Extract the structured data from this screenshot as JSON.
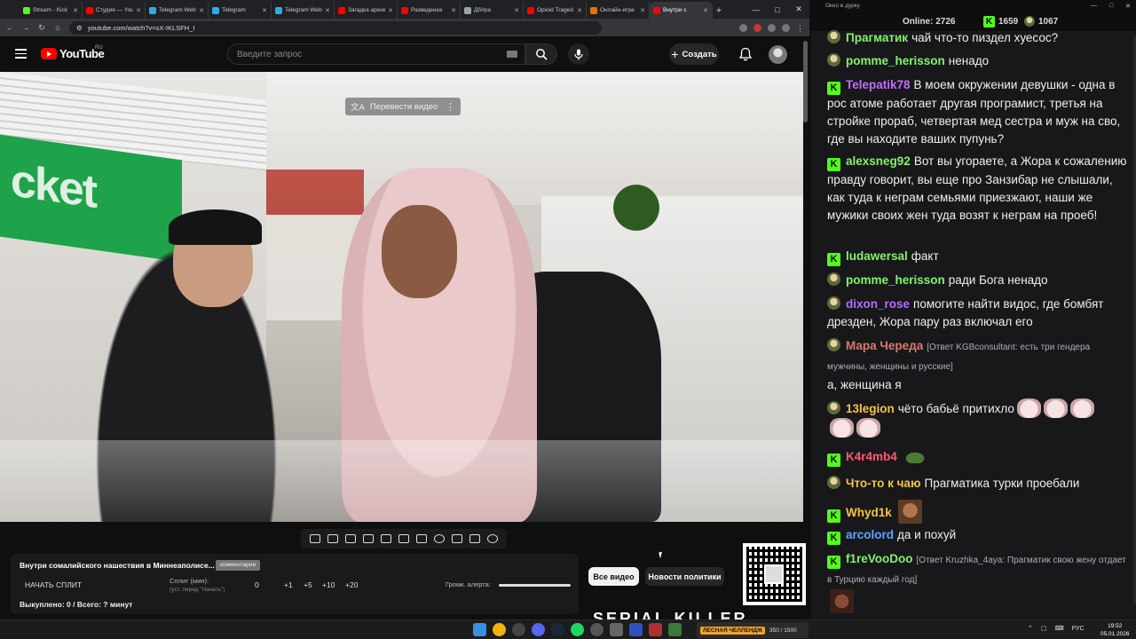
{
  "browser": {
    "tabs": [
      {
        "title": "Stream - Kick",
        "color": "#53fc18"
      },
      {
        "title": "Студия — YouTube",
        "color": "#ff0000"
      },
      {
        "title": "Telegram Web",
        "color": "#2aabee"
      },
      {
        "title": "Telegram",
        "color": "#2aabee"
      },
      {
        "title": "Telegram Web",
        "color": "#2aabee"
      },
      {
        "title": "Загадка архива",
        "color": "#ff0000"
      },
      {
        "title": "Разведенка",
        "color": "#ff0000"
      },
      {
        "title": "Дб#ра",
        "color": "#9aa0a6"
      },
      {
        "title": "Opioid Traged",
        "color": "#ff0000"
      },
      {
        "title": "Онлайн-игра",
        "color": "#e37400"
      },
      {
        "title": "Внутри с",
        "color": "#ff0000"
      }
    ],
    "new_tab": "+",
    "url": "youtube.com/watch?v=sX-IKLSFH_I",
    "window_controls": [
      "—",
      "□",
      "✕"
    ]
  },
  "youtube": {
    "logo_text": "YouTube",
    "region": "RU",
    "search_placeholder": "Введите запрос",
    "create_label": "Создать",
    "create_plus": "+"
  },
  "video": {
    "translate_label": "Перевести видео",
    "sign_text": "cket"
  },
  "panel": {
    "title": "Внутри сомалийского нашествия в Миннеаполисе...",
    "tag": "комментарии",
    "start_split": "НАЧАТЬ СПЛИТ",
    "split_label": "Сплит (мин):",
    "split_hint": "(уст. перед \"Начать\")",
    "split_value": "0",
    "steps": [
      "+1",
      "+5",
      "+10",
      "+20"
    ],
    "volume_label": "Громк. алерта:",
    "volume_level": 1.0,
    "bought": "Выкуплено: 0 / Всего: ? минут"
  },
  "chips": {
    "all_videos": "Все видео",
    "policy_news": "Новости политики"
  },
  "banner_text": "SERIAL KILLER",
  "chat": {
    "window_title": "Окно в дурку",
    "online_label": "Online:",
    "online_count": "2726",
    "kick_count": "1659",
    "sub_count": "1067",
    "messages": [
      {
        "badge": "sub",
        "user": "Прагматик",
        "color": "#83f36a",
        "text": "чай что-то пиздел хуесос?"
      },
      {
        "badge": "sub",
        "user": "pomme_herisson",
        "color": "#83f36a",
        "text": "ненадо"
      },
      {
        "badge": "kick",
        "user": "Telepatik78",
        "color": "#c56bff",
        "text": "В моем окружении девушки - одна в рос атоме работает другая програмист, третья на стройке прораб, четвертая мед сестра и муж на сво, где вы находите ваших пупунь?"
      },
      {
        "badge": "kick",
        "user": "alexsneg92",
        "color": "#83f36a",
        "text": "Вот вы угораете, а Жора к сожалению правду говорит, вы еще про Занзибар не слышали, как туда к неграм семьями приезжают, наши же мужики своих жен туда возят к неграм на проеб!"
      },
      {
        "badge": "kick",
        "user": "ludawersal",
        "color": "#83f36a",
        "text": "факт"
      },
      {
        "badge": "sub",
        "user": "pomme_herisson",
        "color": "#83f36a",
        "text": "ради Бога ненадо"
      },
      {
        "badge": "sub",
        "user": "dixon_rose",
        "color": "#b86bff",
        "text": "помогите найти видос, где бомбят дрезден, Жора пару раз включал его"
      },
      {
        "badge": "sub",
        "user": "Мара Череда",
        "color": "#d97a6c",
        "reply": "[Ответ KGBconsultant: есть три гендера мужчины, женщины и русские]",
        "text": "а, женщина я"
      },
      {
        "badge": "sub",
        "user": "13legion",
        "color": "#f5c443",
        "text": "чёто бабьё   притихло"
      },
      {
        "badge": "kick",
        "user": "K4r4mb4",
        "color": "#ff5a6e",
        "text": ""
      },
      {
        "badge": "sub",
        "user": "Что-то к чаю",
        "color": "#f5c443",
        "text": "Прагматика турки проебали"
      },
      {
        "badge": "kick",
        "user": "Whyd1k",
        "color": "#f5c443",
        "text": ""
      },
      {
        "badge": "kick",
        "user": "arcolord",
        "color": "#5aa7ff",
        "text": "да и похуй"
      },
      {
        "badge": "kick",
        "user": "f1reVooDoo",
        "color": "#83f36a",
        "reply": "[Ответ Kruzhka_4aya: Прагматик свою жену отдает в Турцию каждый год]",
        "text": ""
      }
    ]
  },
  "taskbar": {
    "notify_tag": "ЛЕСНАЯ ЧЕЛЛЕНДЖ",
    "notify_text": "350 / 1500",
    "lang": "РУС",
    "time": "19:52",
    "date": "05.01.2026"
  }
}
